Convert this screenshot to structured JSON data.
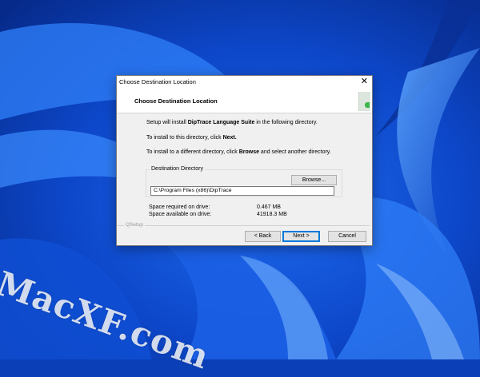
{
  "watermark": "MacXF.com",
  "dialog": {
    "title": "Choose Destination Location",
    "close_glyph": "✕",
    "heading": "Choose Destination Location",
    "setup_prefix": "Setup will install ",
    "product_name": "DipTrace Language Suite",
    "setup_suffix": " in the following directory.",
    "install_here_prefix": "To install to this directory, click ",
    "install_here_bold": "Next.",
    "install_other_prefix": "To install to a different directory, click ",
    "install_other_bold": "Browse",
    "install_other_suffix": " and select another directory.",
    "destination_legend": "Destination Directory",
    "browse_label": "Browse...",
    "destination_path": "C:\\Program Files (x86)\\DipTrace",
    "space_required_label": "Space required on drive:",
    "space_required_value": "0.467 MB",
    "space_available_label": "Space available on drive:",
    "space_available_value": "41918.3 MB",
    "footer_brand": "QSetup",
    "back_label": "< Back",
    "next_label": "Next >",
    "cancel_label": "Cancel"
  },
  "colors": {
    "desktop_blue": "#0b3fb8",
    "accent": "#0078d7",
    "logo_green": "#3db54a"
  }
}
